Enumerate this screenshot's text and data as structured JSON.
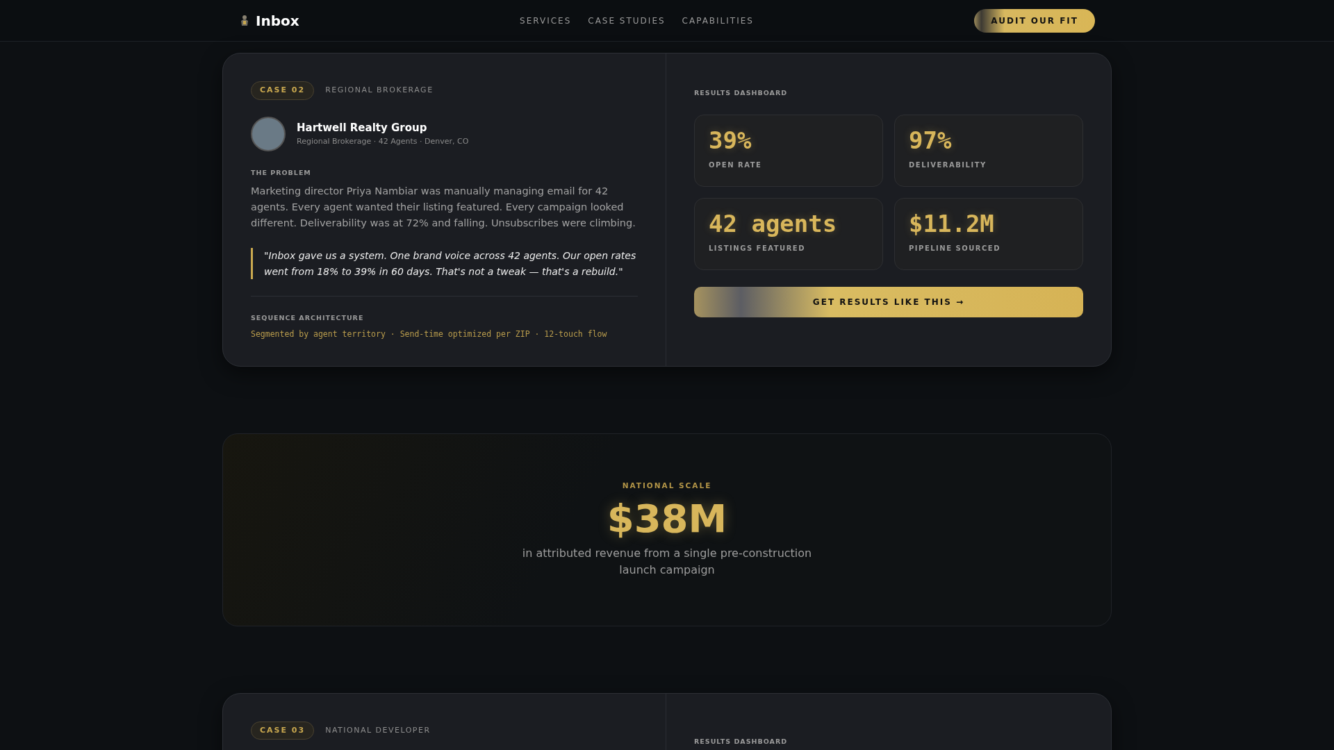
{
  "nav": {
    "brand": "Inbox",
    "links": [
      "SERVICES",
      "CASE STUDIES",
      "CAPABILITIES"
    ],
    "cta": "AUDIT OUR FIT"
  },
  "cases": [
    {
      "case_label": "CASE 02",
      "category": "REGIONAL BROKERAGE",
      "client": {
        "name": "Hartwell Realty Group",
        "meta": "Regional Brokerage · 42 Agents · Denver, CO"
      },
      "problem_heading": "THE PROBLEM",
      "problem": "Marketing director Priya Nambiar was manually managing email for 42 agents. Every agent wanted their listing featured. Every campaign looked different. Deliverability was at 72% and falling. Unsubscribes were climbing.",
      "quote": "\"Inbox gave us a system. One brand voice across 42 agents. Our open rates went from 18% to 39% in 60 days. That's not a tweak — that's a rebuild.\"",
      "architecture_heading": "SEQUENCE ARCHITECTURE",
      "architecture": "Segmented by agent territory · Send-time optimized per ZIP · 12-touch flow",
      "dashboard_heading": "RESULTS DASHBOARD",
      "stats": [
        {
          "value": "39%",
          "label": "OPEN RATE"
        },
        {
          "value": "97%",
          "label": "DELIVERABILITY"
        },
        {
          "value": "42 agents",
          "label": "LISTINGS FEATURED"
        },
        {
          "value": "$11.2M",
          "label": "PIPELINE SOURCED"
        }
      ],
      "cta": "GET RESULTS LIKE THIS →"
    }
  ],
  "highlight": {
    "eyebrow": "NATIONAL SCALE",
    "value": "$38M",
    "caption": "in attributed revenue from a single pre-construction launch campaign"
  },
  "next_case": {
    "case_label": "CASE 03",
    "category": "NATIONAL DEVELOPER",
    "dashboard_heading": "RESULTS DASHBOARD"
  }
}
